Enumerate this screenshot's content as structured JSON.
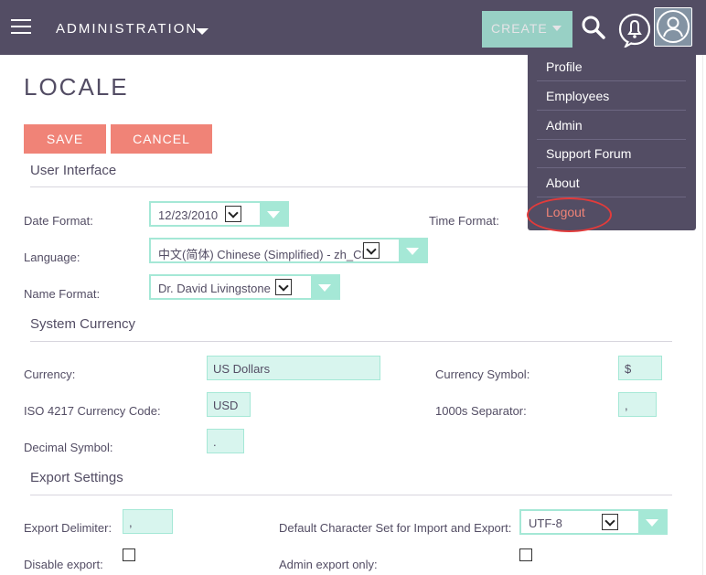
{
  "topbar": {
    "module_title": "ADMINISTRATION",
    "create_label": "CREATE"
  },
  "user_menu": {
    "items": [
      "Profile",
      "Employees",
      "Admin",
      "Support Forum",
      "About",
      "Logout"
    ]
  },
  "page": {
    "title": "LOCALE",
    "save_label": "SAVE",
    "cancel_label": "CANCEL"
  },
  "user_interface": {
    "heading": "User Interface",
    "date_format_label": "Date Format:",
    "date_format_value": "12/23/2010",
    "time_format_label": "Time Format:",
    "language_label": "Language:",
    "language_value": "中文(简体) Chinese (Simplified) - zh_CN",
    "name_format_label": "Name Format:",
    "name_format_value": "Dr. David Livingstone"
  },
  "system_currency": {
    "heading": "System Currency",
    "currency_label": "Currency:",
    "currency_value": "US Dollars",
    "currency_symbol_label": "Currency Symbol:",
    "currency_symbol_value": "$",
    "iso_label": "ISO 4217 Currency Code:",
    "iso_value": "USD",
    "thousands_label": "1000s Separator:",
    "thousands_value": ",",
    "decimal_label": "Decimal Symbol:",
    "decimal_value": "."
  },
  "export_settings": {
    "heading": "Export Settings",
    "delimiter_label": "Export Delimiter:",
    "delimiter_value": ",",
    "charset_label": "Default Character Set for Import and Export:",
    "charset_value": "UTF-8",
    "disable_label": "Disable export:",
    "admin_only_label": "Admin export only:"
  },
  "colors": {
    "topbar": "#534d64",
    "accent": "#a5e8d6",
    "button": "#f08377",
    "annotation": "#e23b3b"
  }
}
